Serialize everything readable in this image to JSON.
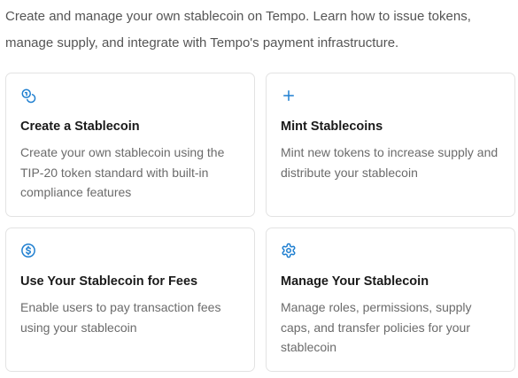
{
  "intro": {
    "line1": "Create and manage your own stablecoin on Tempo. Learn how to issue tokens,",
    "line2": "manage supply, and integrate with Tempo's payment infrastructure."
  },
  "accent_color": "#1f7fd0",
  "cards": [
    {
      "icon": "coins-icon",
      "title": "Create a Stablecoin",
      "description": "Create your own stablecoin using the TIP-20 token standard with built-in compliance features"
    },
    {
      "icon": "plus-icon",
      "title": "Mint Stablecoins",
      "description": "Mint new tokens to increase supply and distribute your stablecoin"
    },
    {
      "icon": "dollar-circle-icon",
      "title": "Use Your Stablecoin for Fees",
      "description": "Enable users to pay transaction fees using your stablecoin"
    },
    {
      "icon": "gear-icon",
      "title": "Manage Your Stablecoin",
      "description": "Manage roles, permissions, supply caps, and transfer policies for your stablecoin"
    }
  ]
}
